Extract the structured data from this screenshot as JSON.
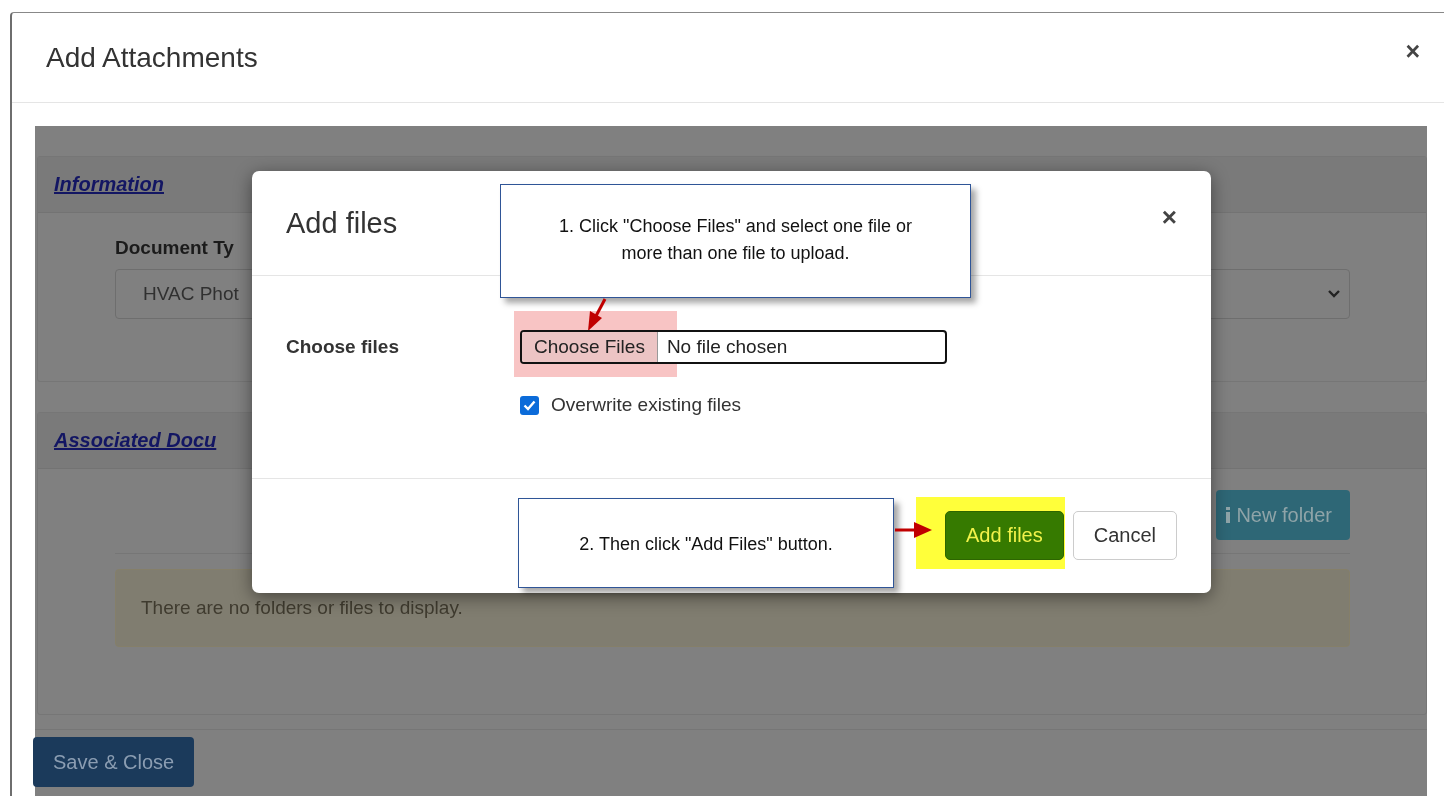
{
  "window": {
    "title": "Add Attachments",
    "close": "×"
  },
  "background": {
    "sections": [
      {
        "title": "Information"
      },
      {
        "title": "Associated Docu"
      }
    ],
    "document_type_label": "Document Ty",
    "document_type_value": "HVAC Phot",
    "new_folder_button": "New folder",
    "empty_message": "There are no folders or files to display.",
    "save_button": "Save & Close"
  },
  "dialog": {
    "title": "Add files",
    "close": "×",
    "choose_label": "Choose files",
    "file_button": "Choose Files",
    "file_status": "No file chosen",
    "overwrite": {
      "label": "Overwrite existing files",
      "checked": true
    },
    "buttons": [
      {
        "label": "Add files",
        "kind": "primary"
      },
      {
        "label": "Cancel",
        "kind": "default"
      }
    ]
  },
  "callouts": [
    {
      "text": "1. Click \"Choose Files\" and select one file or more than one file to upload."
    },
    {
      "text": "2. Then click \"Add Files\" button."
    }
  ]
}
